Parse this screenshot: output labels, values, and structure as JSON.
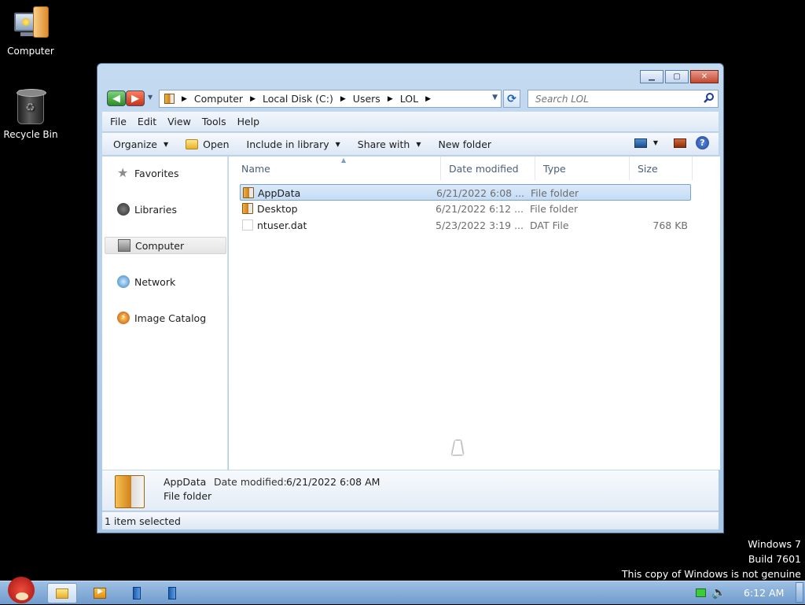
{
  "desktop": {
    "icons": [
      {
        "label": "Computer"
      },
      {
        "label": "Recycle Bin"
      }
    ]
  },
  "explorer": {
    "address": {
      "crumbs": [
        "Computer",
        "Local Disk (C:)",
        "Users",
        "LOL"
      ]
    },
    "search": {
      "placeholder": "Search LOL"
    },
    "menu": [
      "File",
      "Edit",
      "View",
      "Tools",
      "Help"
    ],
    "toolbar": {
      "organize": "Organize",
      "open": "Open",
      "include_in_library": "Include in library",
      "share_with": "Share with",
      "new_folder": "New folder"
    },
    "nav": [
      "Favorites",
      "Libraries",
      "Computer",
      "Network",
      "Image Catalog"
    ],
    "selected_nav": "Computer",
    "columns": [
      "Name",
      "Date modified",
      "Type",
      "Size"
    ],
    "files": [
      {
        "name": "AppData",
        "date": "6/21/2022 6:08 ...",
        "type": "File folder",
        "size": "",
        "icon": "folder-icon",
        "selected": true
      },
      {
        "name": "Desktop",
        "date": "6/21/2022 6:12 ...",
        "type": "File folder",
        "size": "",
        "icon": "folder-icon",
        "selected": false
      },
      {
        "name": "ntuser.dat",
        "date": "5/23/2022 3:19 ...",
        "type": "DAT File",
        "size": "768 KB",
        "icon": "file-icon",
        "selected": false
      }
    ],
    "details": {
      "name": "AppData",
      "modified_label": "Date modified:",
      "modified_value": "6/21/2022 6:08 AM",
      "type": "File folder"
    },
    "status": "1 item selected"
  },
  "watermark": [
    "Windows 7",
    "Build 7601",
    "This copy of Windows is not genuine"
  ],
  "taskbar": {
    "clock": "6:12 AM"
  }
}
